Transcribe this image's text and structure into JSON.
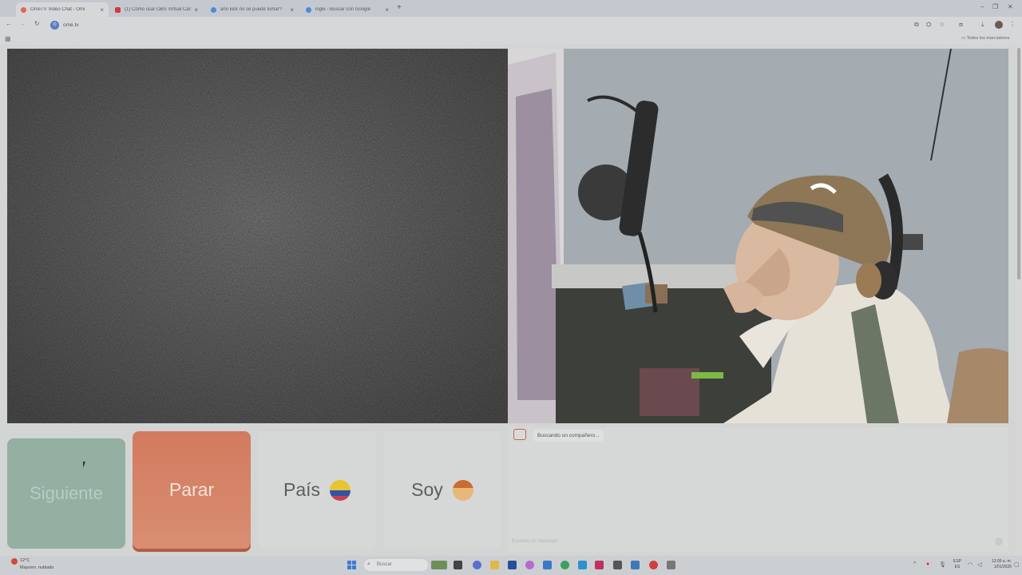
{
  "browser": {
    "tabs": [
      {
        "label": "OmeTV Video Chat - Omi",
        "active": true,
        "favicon_color": "#e06a4a"
      },
      {
        "label": "(1) Cómo usar OBS Virtual Cam",
        "active": false,
        "favicon_color": "#d23a3a"
      },
      {
        "label": "ann kick no se puede tomar?",
        "active": false,
        "favicon_color": "#4a8cd6"
      },
      {
        "label": "ingle - Buscar con Google",
        "active": false,
        "favicon_color": "#4a8cd6"
      }
    ],
    "new_tab_icon": "plus-icon",
    "url": "ome.tv",
    "all_bookmarks_label": "Todos los marcadores"
  },
  "page": {
    "buttons": {
      "next_label": "Siguiente",
      "stop_label": "Parar",
      "country_label": "País",
      "gender_label": "Soy"
    },
    "chat": {
      "status": "Buscando un compañero...",
      "input_placeholder": "Escribe un mensaje"
    },
    "colors": {
      "next": "#93b0a2",
      "stop": "#d27a5e",
      "neutral": "#d6d7d7"
    }
  },
  "taskbar": {
    "weather_temp": "12°C",
    "weather_desc": "Mayorm. nublado",
    "search_placeholder": "Buscar",
    "lang_top": "ESP",
    "lang_bottom": "ES",
    "time": "12:09 a. m.",
    "date": "1/01/2026"
  }
}
